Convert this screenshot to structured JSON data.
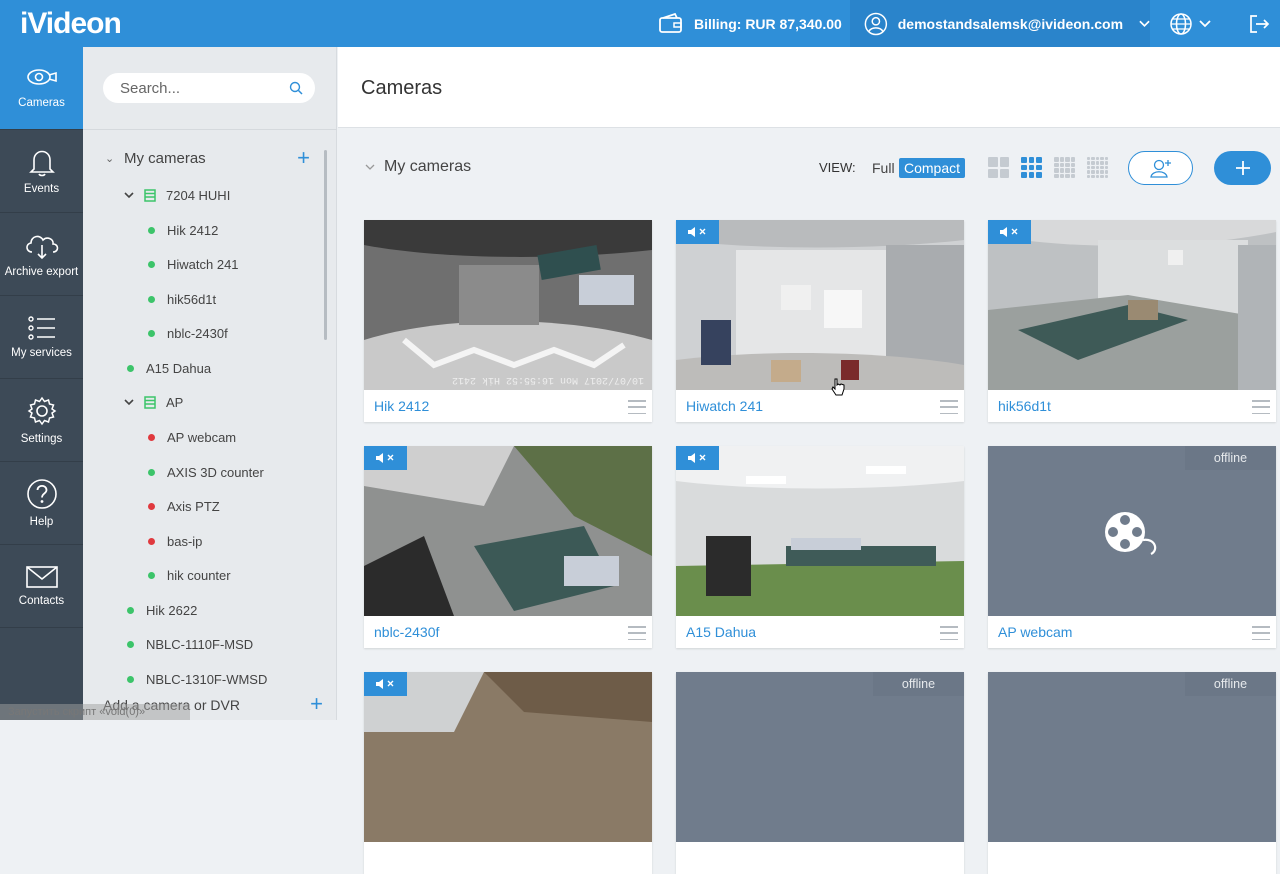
{
  "brand": {
    "logo_text": "iVideon",
    "accent": "#2f8fd8",
    "online": "#3cc46a",
    "offline": "#e0393e"
  },
  "topbar": {
    "billing": "Billing: RUR 87,340.00",
    "account": "demostandsalemsk@ivideon.com"
  },
  "nav": [
    {
      "label": "Cameras",
      "icon": "cameras-icon"
    },
    {
      "label": "Events",
      "icon": "bell-icon"
    },
    {
      "label": "Archive export",
      "icon": "cloud-download-icon"
    },
    {
      "label": "My services",
      "icon": "list-icon"
    },
    {
      "label": "Settings",
      "icon": "gear-icon"
    },
    {
      "label": "Help",
      "icon": "help-icon"
    },
    {
      "label": "Contacts",
      "icon": "mail-icon"
    }
  ],
  "sidebar": {
    "search_placeholder": "Search...",
    "group": "My cameras",
    "items": [
      {
        "label": "7204 HUHI",
        "type": "dvr"
      },
      {
        "label": "Hik 2412",
        "status": "online"
      },
      {
        "label": "Hiwatch 241",
        "status": "online"
      },
      {
        "label": "hik56d1t",
        "status": "online"
      },
      {
        "label": "nblc-2430f",
        "status": "online"
      },
      {
        "label": "A15 Dahua",
        "status": "online"
      },
      {
        "label": "AP",
        "type": "dvr"
      },
      {
        "label": "AP webcam",
        "status": "offline"
      },
      {
        "label": "AXIS 3D counter",
        "status": "online"
      },
      {
        "label": "Axis PTZ",
        "status": "offline"
      },
      {
        "label": "bas-ip",
        "status": "offline"
      },
      {
        "label": "hik counter",
        "status": "online"
      },
      {
        "label": "Hik 2622",
        "status": "online"
      },
      {
        "label": "NBLC-1110F-MSD",
        "status": "online"
      },
      {
        "label": "NBLC-1310F-WMSD",
        "status": "online"
      }
    ],
    "add_camera": "Add a camera or DVR"
  },
  "main": {
    "title": "Cameras",
    "group_title": "My cameras",
    "view_label": "VIEW:",
    "view_full": "Full",
    "view_compact": "Compact",
    "offline_label": "offline",
    "cameras": [
      {
        "name": "Hik 2412",
        "muted": false,
        "offline": false
      },
      {
        "name": "Hiwatch 241",
        "muted": true,
        "offline": false
      },
      {
        "name": "hik56d1t",
        "muted": true,
        "offline": false
      },
      {
        "name": "nblc-2430f",
        "muted": true,
        "offline": false
      },
      {
        "name": "A15 Dahua",
        "muted": true,
        "offline": false
      },
      {
        "name": "AP webcam",
        "muted": false,
        "offline": true
      }
    ],
    "osd_text": "10/07/2017 Mon 16:55:52  Hik 2412"
  },
  "status_overlay": "Запустить скрипт «void(0)»"
}
